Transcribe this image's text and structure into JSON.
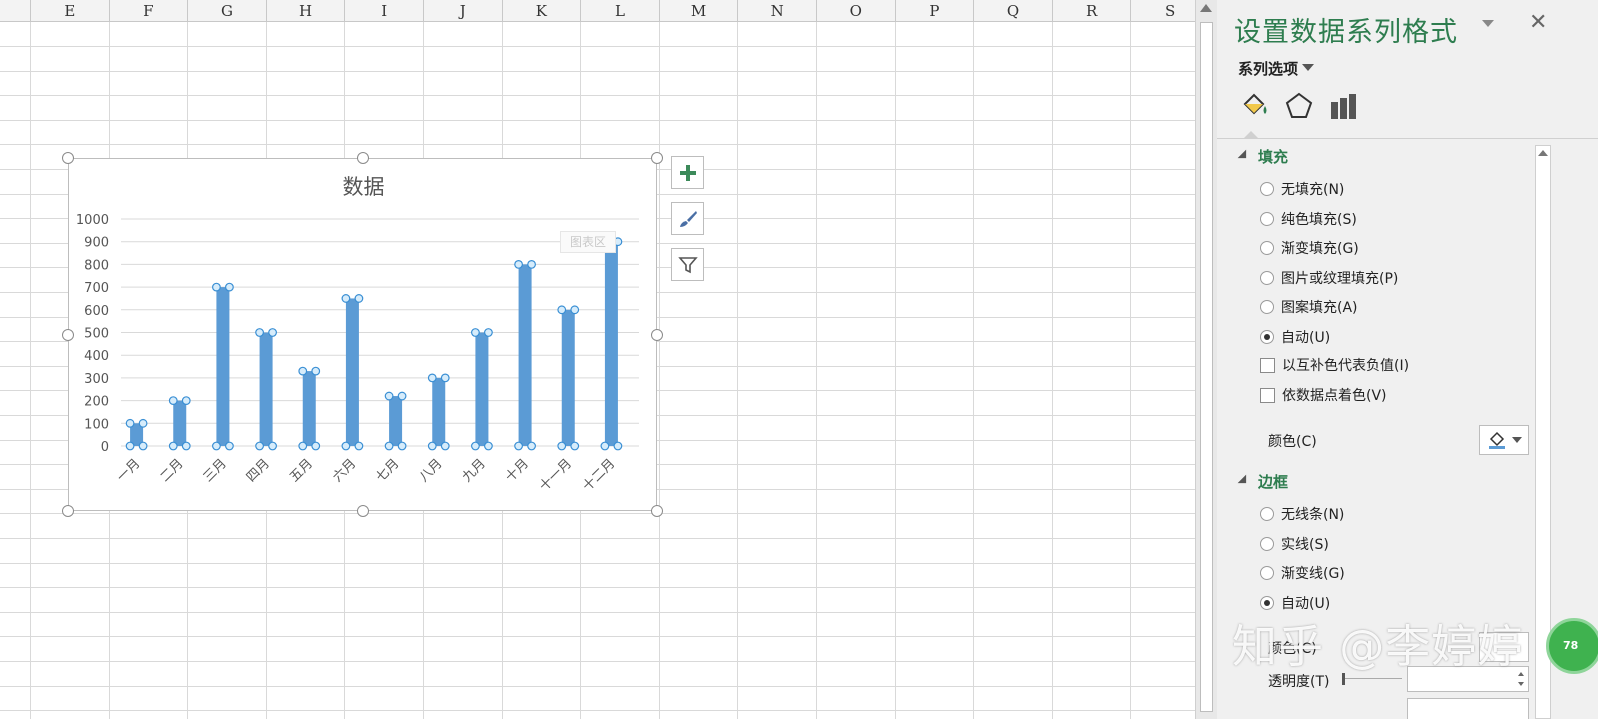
{
  "sheet": {
    "columns": [
      "E",
      "F",
      "G",
      "H",
      "I",
      "J",
      "K",
      "L",
      "M",
      "N",
      "O",
      "P",
      "Q",
      "R",
      "S"
    ]
  },
  "chart_data": {
    "type": "bar",
    "title": "数据",
    "categories": [
      "一月",
      "二月",
      "三月",
      "四月",
      "五月",
      "六月",
      "七月",
      "八月",
      "九月",
      "十月",
      "十一月",
      "十二月"
    ],
    "values": [
      100,
      200,
      700,
      500,
      330,
      650,
      220,
      300,
      500,
      800,
      600,
      900
    ],
    "ylim": [
      0,
      1000
    ],
    "yticks": [
      "0",
      "100",
      "200",
      "300",
      "400",
      "500",
      "600",
      "700",
      "800",
      "900",
      "1000"
    ],
    "bar_color": "#5b9bd5",
    "grid": true,
    "series_selected": true,
    "tooltip": "图表区"
  },
  "chart_tools": {
    "add_elements_icon": "plus-icon",
    "styles_icon": "paintbrush-icon",
    "filter_icon": "funnel-icon"
  },
  "pane": {
    "title": "设置数据系列格式",
    "close": "✕",
    "series_options": "系列选项",
    "tabs": [
      "fill-line-icon",
      "effects-icon",
      "series-options-icon"
    ],
    "fill": {
      "heading": "填充",
      "options": [
        {
          "label": "无填充(N)",
          "checked": false
        },
        {
          "label": "纯色填充(S)",
          "checked": false
        },
        {
          "label": "渐变填充(G)",
          "checked": false
        },
        {
          "label": "图片或纹理填充(P)",
          "checked": false
        },
        {
          "label": "图案填充(A)",
          "checked": false
        },
        {
          "label": "自动(U)",
          "checked": true
        }
      ],
      "invert_label": "以互补色代表负值(I)",
      "vary_label": "依数据点着色(V)",
      "color_label": "颜色(C)"
    },
    "border": {
      "heading": "边框",
      "options": [
        {
          "label": "无线条(N)",
          "checked": false
        },
        {
          "label": "实线(S)",
          "checked": false
        },
        {
          "label": "渐变线(G)",
          "checked": false
        },
        {
          "label": "自动(U)",
          "checked": true
        }
      ],
      "color_label": "颜色(C)",
      "transparency_label": "透明度(T)"
    }
  },
  "watermark": "知乎 @李婷婷",
  "badge": "78",
  "colors": {
    "accent": "#2e7d4f",
    "bar": "#5b9bd5"
  }
}
